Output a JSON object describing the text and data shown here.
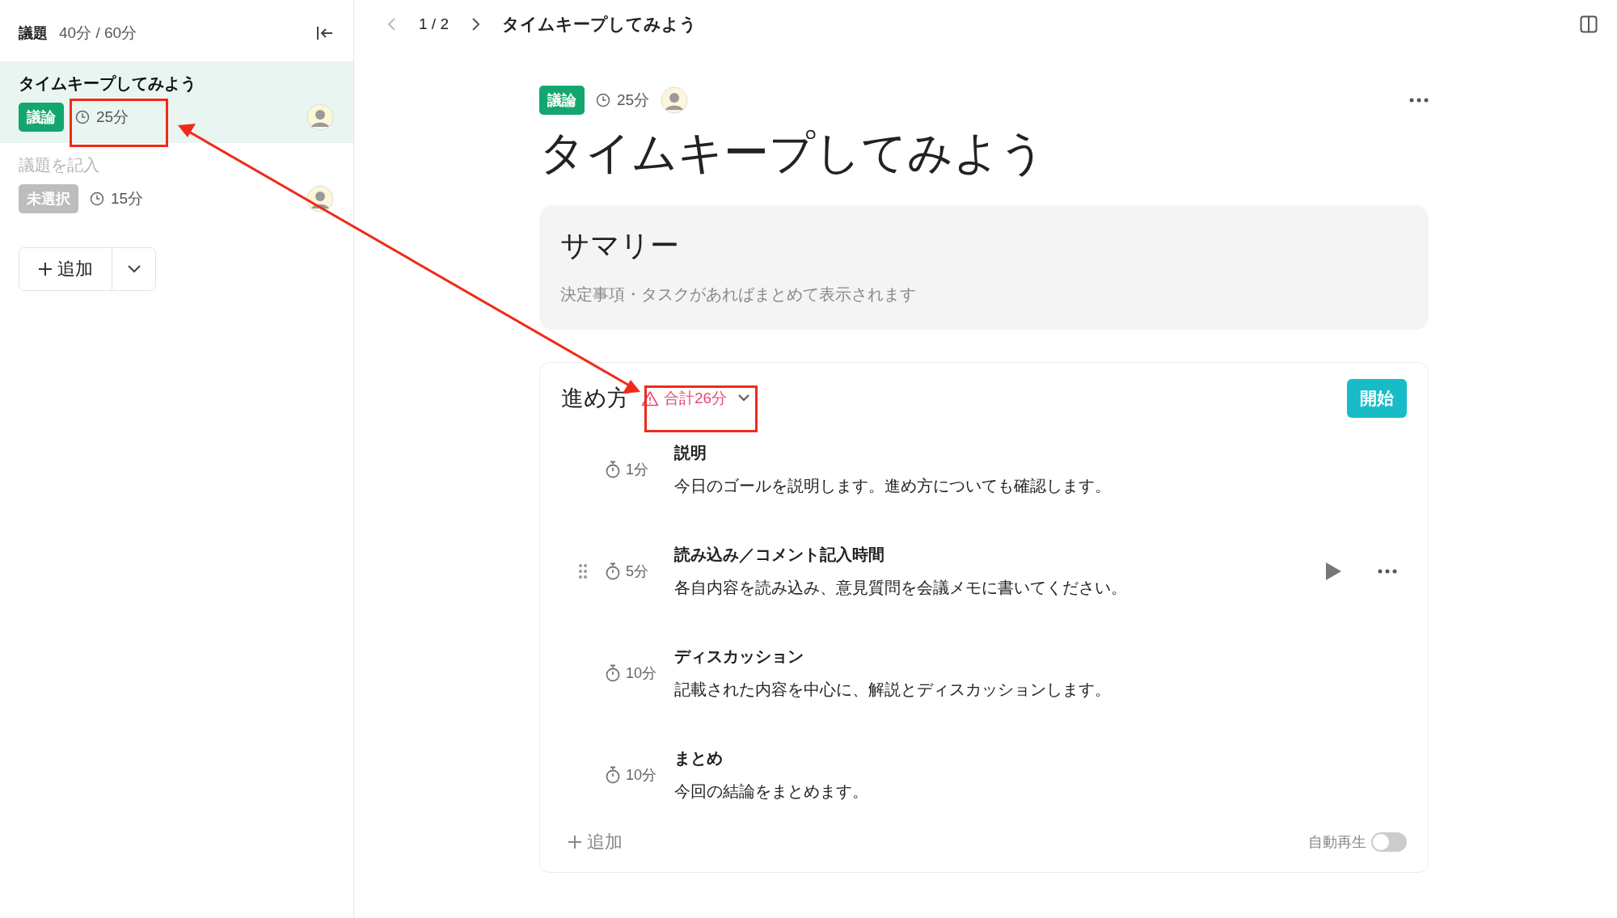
{
  "sidebar": {
    "title": "議題",
    "total": "40分 / 60分",
    "items": [
      {
        "title": "タイムキープしてみよう",
        "placeholder": false,
        "selected": true,
        "tag": {
          "label": "議論",
          "kind": "discussion"
        },
        "duration": "25分"
      },
      {
        "title": "議題を記入",
        "placeholder": true,
        "selected": false,
        "tag": {
          "label": "未選択",
          "kind": "unset"
        },
        "duration": "15分"
      }
    ],
    "add_button": "追加"
  },
  "topbar": {
    "pager": "1 / 2",
    "title": "タイムキープしてみよう"
  },
  "agenda": {
    "tag": {
      "label": "議論",
      "kind": "discussion"
    },
    "duration": "25分",
    "title": "タイムキープしてみよう"
  },
  "summary": {
    "title": "サマリー",
    "placeholder": "決定事項・タスクがあればまとめて表示されます"
  },
  "steps_card": {
    "title": "進め方",
    "total_warning": "合計26分",
    "start_button": "開始",
    "steps": [
      {
        "duration": "1分",
        "title": "説明",
        "description": "今日のゴールを説明します。進め方についても確認します。",
        "hovered": false
      },
      {
        "duration": "5分",
        "title": "読み込み／コメント記入時間",
        "description": "各自内容を読み込み、意見質問を会議メモに書いてください。",
        "hovered": true
      },
      {
        "duration": "10分",
        "title": "ディスカッション",
        "description": "記載された内容を中心に、解説とディスカッションします。",
        "hovered": false
      },
      {
        "duration": "10分",
        "title": "まとめ",
        "description": "今回の結論をまとめます。",
        "hovered": false
      }
    ],
    "add_button": "追加",
    "autoplay": {
      "label": "自動再生",
      "on": false
    }
  }
}
